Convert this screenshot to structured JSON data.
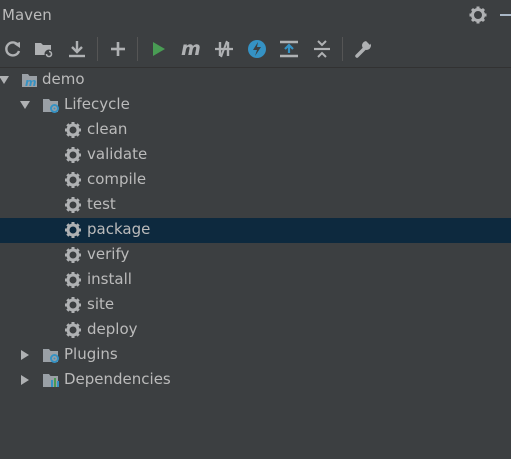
{
  "panel": {
    "title": "Maven"
  },
  "toolbar": {
    "icons": [
      "refresh-icon",
      "generate-sources-icon",
      "download-icon",
      "add-icon",
      "run-icon",
      "execute-goal-icon",
      "toggle-offline-icon",
      "skip-tests-icon",
      "show-dependencies-icon",
      "collapse-all-icon",
      "settings-wrench-icon"
    ]
  },
  "tree": {
    "root": {
      "label": "demo"
    },
    "lifecycle": {
      "label": "Lifecycle",
      "goals": [
        "clean",
        "validate",
        "compile",
        "test",
        "package",
        "verify",
        "install",
        "site",
        "deploy"
      ]
    },
    "plugins": {
      "label": "Plugins"
    },
    "dependencies": {
      "label": "Dependencies"
    },
    "selected_goal": "package"
  },
  "colors": {
    "background": "#3c3f41",
    "selection": "#0d293e",
    "run_green": "#499c54",
    "accent_blue": "#3592c4"
  }
}
